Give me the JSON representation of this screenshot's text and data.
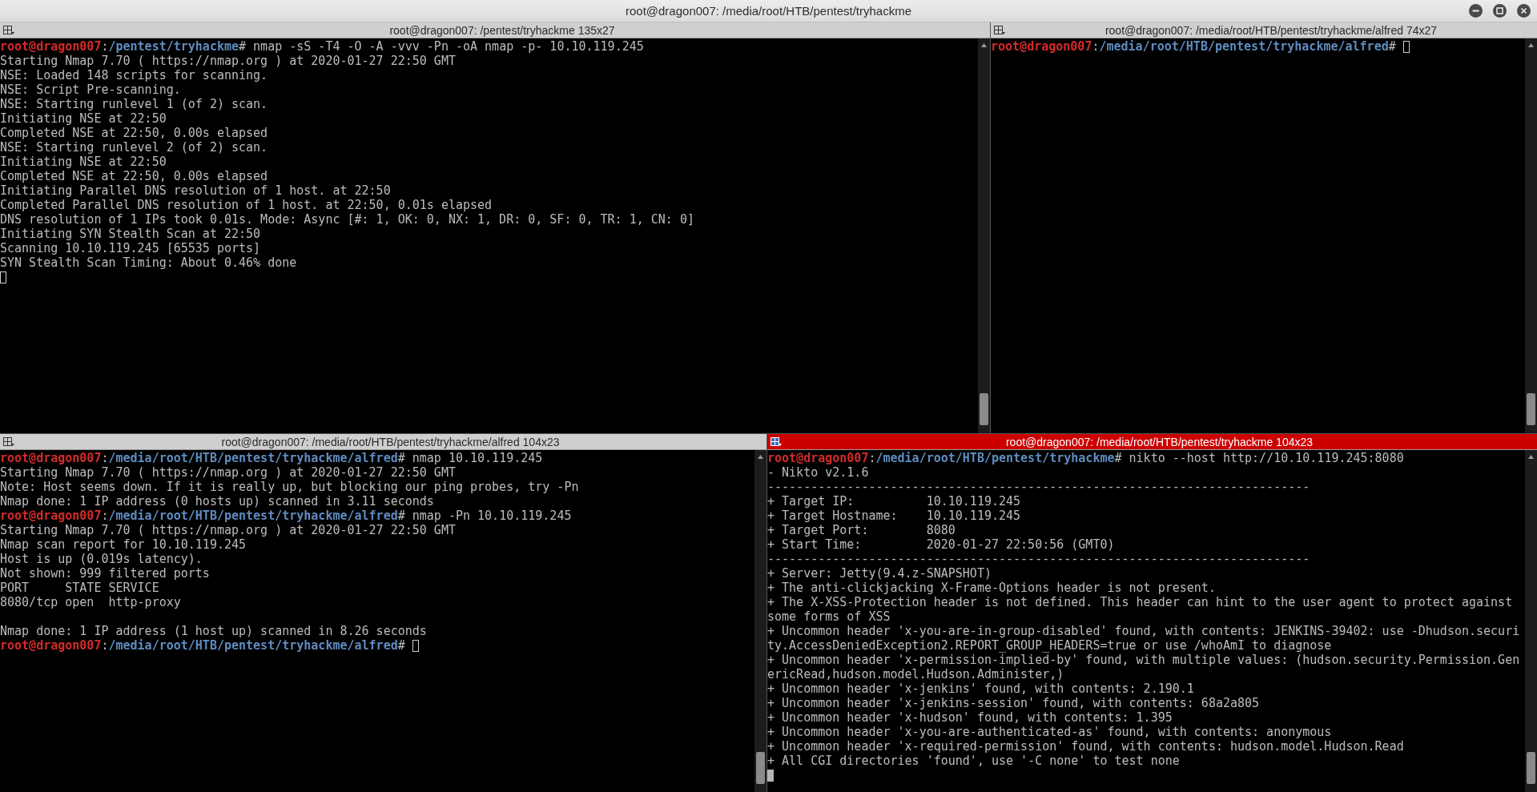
{
  "window": {
    "title": "root@dragon007: /media/root/HTB/pentest/tryhackme"
  },
  "rows": [
    {
      "panes": [
        {
          "title": "root@dragon007: /pentest/tryhackme 135x27",
          "focused": false,
          "lines": [
            {
              "kind": "prompt",
              "user": "root@dragon007",
              "separator": ":",
              "path": "/pentest/tryhackme",
              "symbol": "#",
              "command": "nmap -sS -T4 -O -A -vvv -Pn -oA nmap -p- 10.10.119.245"
            },
            {
              "kind": "output",
              "text": "Starting Nmap 7.70 ( https://nmap.org ) at 2020-01-27 22:50 GMT"
            },
            {
              "kind": "output",
              "text": "NSE: Loaded 148 scripts for scanning."
            },
            {
              "kind": "output",
              "text": "NSE: Script Pre-scanning."
            },
            {
              "kind": "output",
              "text": "NSE: Starting runlevel 1 (of 2) scan."
            },
            {
              "kind": "output",
              "text": "Initiating NSE at 22:50"
            },
            {
              "kind": "output",
              "text": "Completed NSE at 22:50, 0.00s elapsed"
            },
            {
              "kind": "output",
              "text": "NSE: Starting runlevel 2 (of 2) scan."
            },
            {
              "kind": "output",
              "text": "Initiating NSE at 22:50"
            },
            {
              "kind": "output",
              "text": "Completed NSE at 22:50, 0.00s elapsed"
            },
            {
              "kind": "output",
              "text": "Initiating Parallel DNS resolution of 1 host. at 22:50"
            },
            {
              "kind": "output",
              "text": "Completed Parallel DNS resolution of 1 host. at 22:50, 0.01s elapsed"
            },
            {
              "kind": "output",
              "text": "DNS resolution of 1 IPs took 0.01s. Mode: Async [#: 1, OK: 0, NX: 1, DR: 0, SF: 0, TR: 1, CN: 0]"
            },
            {
              "kind": "output",
              "text": "Initiating SYN Stealth Scan at 22:50"
            },
            {
              "kind": "output",
              "text": "Scanning 10.10.119.245 [65535 ports]"
            },
            {
              "kind": "output",
              "text": "SYN Stealth Scan Timing: About 0.46% done"
            },
            {
              "kind": "cursor"
            }
          ]
        },
        {
          "title": "root@dragon007: /media/root/HTB/pentest/tryhackme/alfred 74x27",
          "focused": false,
          "lines": [
            {
              "kind": "prompt",
              "user": "root@dragon007",
              "separator": ":",
              "path": "/media/root/HTB/pentest/tryhackme/alfred",
              "symbol": "#",
              "cursor": true
            }
          ]
        }
      ]
    },
    {
      "panes": [
        {
          "title": "root@dragon007: /media/root/HTB/pentest/tryhackme/alfred 104x23",
          "focused": false,
          "lines": [
            {
              "kind": "prompt",
              "user": "root@dragon007",
              "separator": ":",
              "path": "/media/root/HTB/pentest/tryhackme/alfred",
              "symbol": "#",
              "command": "nmap 10.10.119.245"
            },
            {
              "kind": "output",
              "text": "Starting Nmap 7.70 ( https://nmap.org ) at 2020-01-27 22:50 GMT"
            },
            {
              "kind": "output",
              "text": "Note: Host seems down. If it is really up, but blocking our ping probes, try -Pn"
            },
            {
              "kind": "output",
              "text": "Nmap done: 1 IP address (0 hosts up) scanned in 3.11 seconds"
            },
            {
              "kind": "prompt",
              "user": "root@dragon007",
              "separator": ":",
              "path": "/media/root/HTB/pentest/tryhackme/alfred",
              "symbol": "#",
              "command": "nmap -Pn 10.10.119.245"
            },
            {
              "kind": "output",
              "text": "Starting Nmap 7.70 ( https://nmap.org ) at 2020-01-27 22:50 GMT"
            },
            {
              "kind": "output",
              "text": "Nmap scan report for 10.10.119.245"
            },
            {
              "kind": "output",
              "text": "Host is up (0.019s latency)."
            },
            {
              "kind": "output",
              "text": "Not shown: 999 filtered ports"
            },
            {
              "kind": "output",
              "text": "PORT     STATE SERVICE"
            },
            {
              "kind": "output",
              "text": "8080/tcp open  http-proxy"
            },
            {
              "kind": "blank"
            },
            {
              "kind": "output",
              "text": "Nmap done: 1 IP address (1 host up) scanned in 8.26 seconds"
            },
            {
              "kind": "prompt",
              "user": "root@dragon007",
              "separator": ":",
              "path": "/media/root/HTB/pentest/tryhackme/alfred",
              "symbol": "#",
              "cursor": true
            }
          ]
        },
        {
          "title": "root@dragon007: /media/root/HTB/pentest/tryhackme 104x23",
          "focused": true,
          "lines": [
            {
              "kind": "prompt",
              "user": "root@dragon007",
              "separator": ":",
              "path": "/media/root/HTB/pentest/tryhackme",
              "symbol": "#",
              "command": "nikto --host http://10.10.119.245:8080"
            },
            {
              "kind": "output",
              "text": "- Nikto v2.1.6"
            },
            {
              "kind": "output",
              "text": "---------------------------------------------------------------------------"
            },
            {
              "kind": "output",
              "text": "+ Target IP:          10.10.119.245"
            },
            {
              "kind": "output",
              "text": "+ Target Hostname:    10.10.119.245"
            },
            {
              "kind": "output",
              "text": "+ Target Port:        8080"
            },
            {
              "kind": "output",
              "text": "+ Start Time:         2020-01-27 22:50:56 (GMT0)"
            },
            {
              "kind": "output",
              "text": "---------------------------------------------------------------------------"
            },
            {
              "kind": "output",
              "text": "+ Server: Jetty(9.4.z-SNAPSHOT)"
            },
            {
              "kind": "output",
              "text": "+ The anti-clickjacking X-Frame-Options header is not present."
            },
            {
              "kind": "output",
              "text": "+ The X-XSS-Protection header is not defined. This header can hint to the user agent to protect against"
            },
            {
              "kind": "output",
              "text": "some forms of XSS"
            },
            {
              "kind": "output",
              "text": "+ Uncommon header 'x-you-are-in-group-disabled' found, with contents: JENKINS-39402: use -Dhudson.securi"
            },
            {
              "kind": "output",
              "text": "ty.AccessDeniedException2.REPORT_GROUP_HEADERS=true or use /whoAmI to diagnose"
            },
            {
              "kind": "output",
              "text": "+ Uncommon header 'x-permission-implied-by' found, with multiple values: (hudson.security.Permission.Gen"
            },
            {
              "kind": "output",
              "text": "ericRead,hudson.model.Hudson.Administer,)"
            },
            {
              "kind": "output",
              "text": "+ Uncommon header 'x-jenkins' found, with contents: 2.190.1"
            },
            {
              "kind": "output",
              "text": "+ Uncommon header 'x-jenkins-session' found, with contents: 68a2a805"
            },
            {
              "kind": "output",
              "text": "+ Uncommon header 'x-hudson' found, with contents: 1.395"
            },
            {
              "kind": "output",
              "text": "+ Uncommon header 'x-you-are-authenticated-as' found, with contents: anonymous"
            },
            {
              "kind": "output",
              "text": "+ Uncommon header 'x-required-permission' found, with contents: hudson.model.Hudson.Read"
            },
            {
              "kind": "output",
              "text": "+ All CGI directories 'found', use '-C none' to test none"
            },
            {
              "kind": "cursor"
            }
          ]
        }
      ]
    }
  ]
}
